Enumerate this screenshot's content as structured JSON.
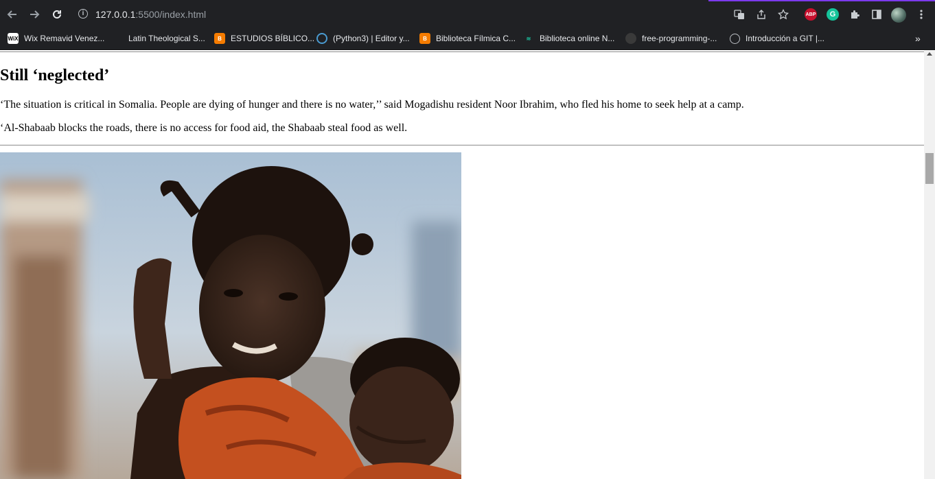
{
  "browser": {
    "url_host": "127.0.0.1",
    "url_rest": ":5500/index.html",
    "abp_label": "ABP",
    "grammarly_label": "G",
    "more_bookmarks_label": "»"
  },
  "bookmarks": [
    {
      "label": "Wix Remavid Venez...",
      "icon": "wix-icon",
      "fav": "WiX"
    },
    {
      "label": "Latin Theological S...",
      "icon": "seminary-icon",
      "fav": ""
    },
    {
      "label": "ESTUDIOS BÍBLICO...",
      "icon": "blogger-icon",
      "fav": "B"
    },
    {
      "label": "(Python3) | Editor y...",
      "icon": "python-editor-icon",
      "fav": ""
    },
    {
      "label": "Biblioteca Fílmica C...",
      "icon": "blogger-icon",
      "fav": "B"
    },
    {
      "label": "Biblioteca online N...",
      "icon": "stack-icon",
      "fav": "≋"
    },
    {
      "label": "free-programming-...",
      "icon": "github-icon",
      "fav": ""
    },
    {
      "label": "Introducción a GIT |...",
      "icon": "globe-icon",
      "fav": ""
    }
  ],
  "article": {
    "heading": "Still ‘neglected’",
    "paragraphs": [
      "‘The situation is critical in Somalia. People are dying of hunger and there is no water,’’ said Mogadishu resident Noor Ibrahim, who fled his home to seek help at a camp.",
      "‘Al-Shabaab blocks the roads, there is no access for food aid, the Shabaab steal food as well."
    ]
  },
  "colors": {
    "chrome_dark": "#202124",
    "accent_purple": "#7c3aed",
    "abp_red": "#c8102e",
    "grammarly_green": "#15c39a"
  }
}
